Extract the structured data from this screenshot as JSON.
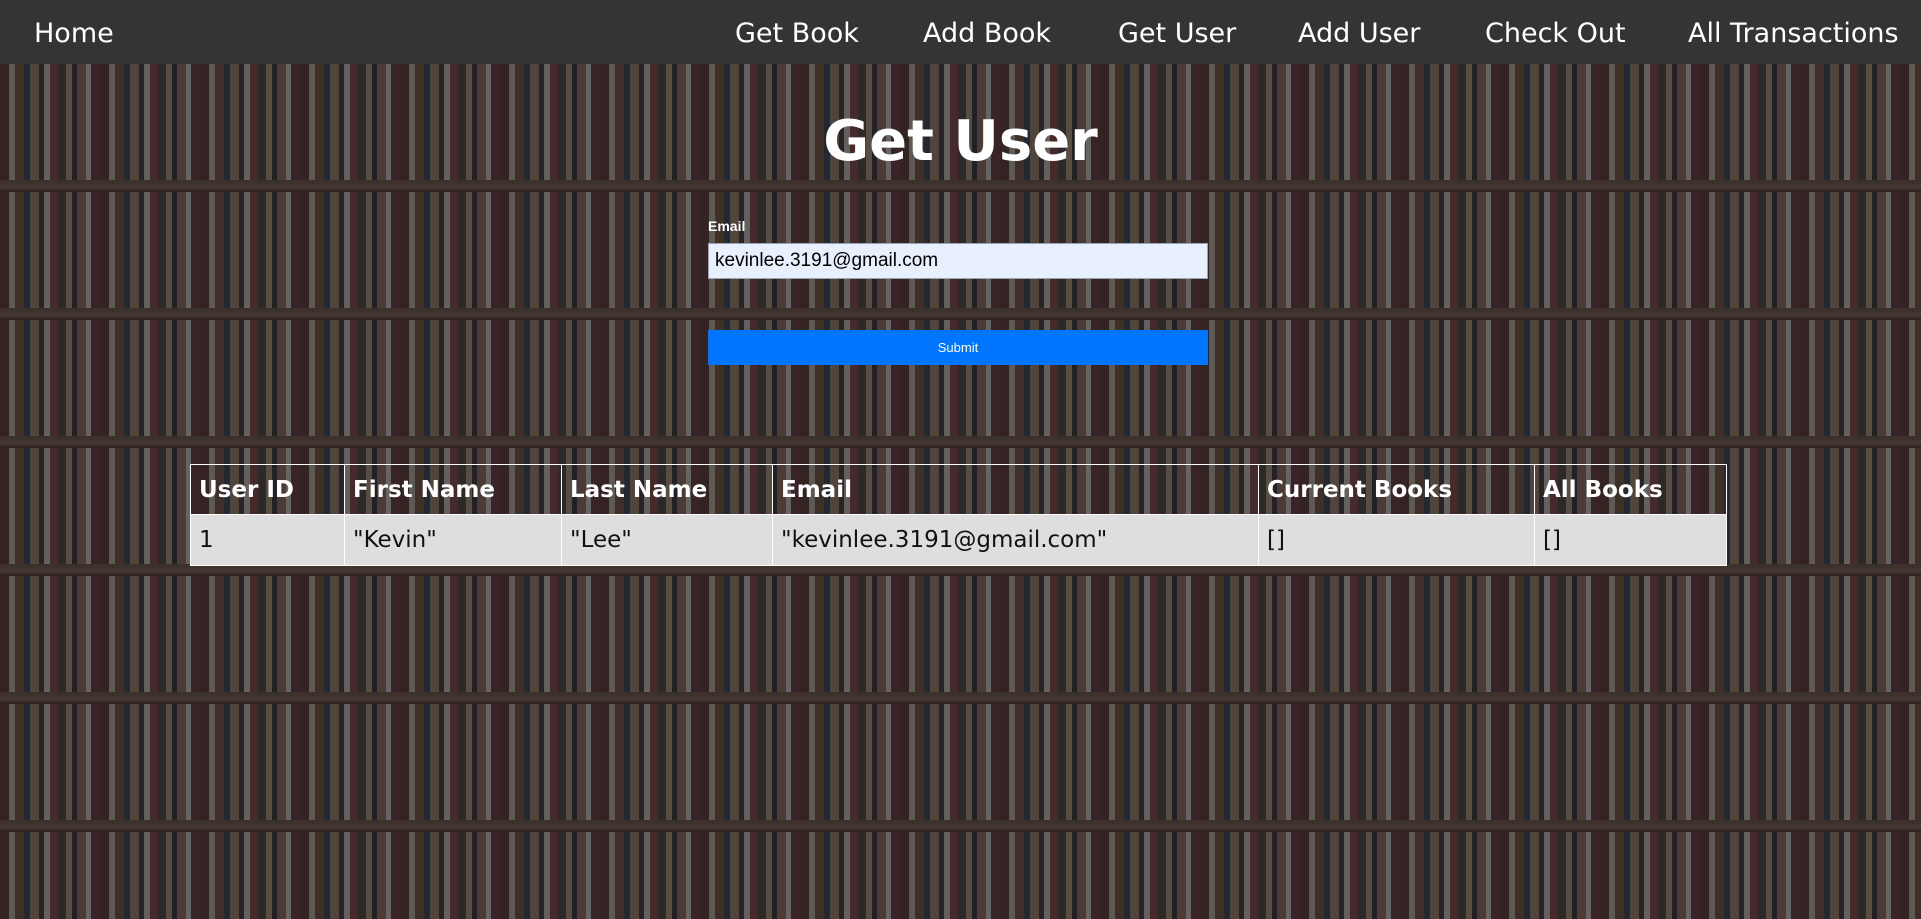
{
  "navbar": {
    "home": "Home",
    "items": [
      {
        "label": "Get Book"
      },
      {
        "label": "Add Book"
      },
      {
        "label": "Get User"
      },
      {
        "label": "Add User"
      },
      {
        "label": "Check Out"
      },
      {
        "label": "All Transactions"
      }
    ]
  },
  "page": {
    "title": "Get User"
  },
  "form": {
    "email_label": "Email",
    "email_value": "kevinlee.3191@gmail.com",
    "submit_label": "Submit"
  },
  "table": {
    "headers": [
      "User ID",
      "First Name",
      "Last Name",
      "Email",
      "Current Books",
      "All Books"
    ],
    "rows": [
      [
        "1",
        "\"Kevin\"",
        "\"Lee\"",
        "\"kevinlee.3191@gmail.com\"",
        "[]",
        "[]"
      ]
    ]
  },
  "colors": {
    "navbar_bg": "#343434",
    "submit_bg": "#0075ff",
    "input_bg": "#e8f0fe",
    "row_bg": "#dedede"
  }
}
